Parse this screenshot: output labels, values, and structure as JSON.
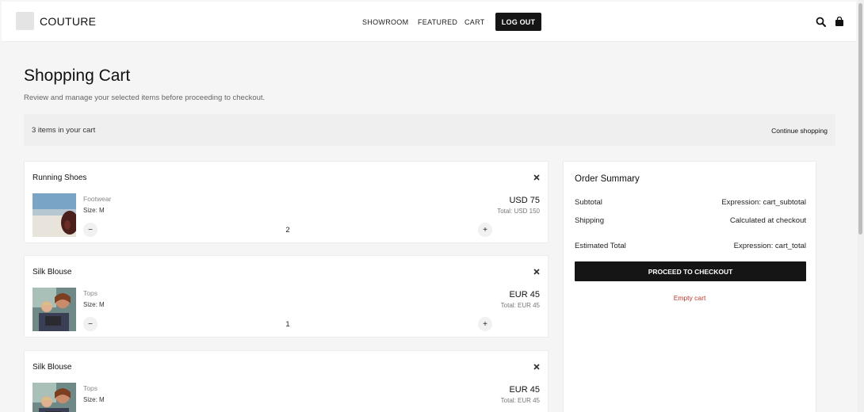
{
  "header": {
    "brand": "COUTURE",
    "nav": [
      "SHOWROOM",
      "FEATURED",
      "CART"
    ],
    "logout_label": "LOG OUT"
  },
  "page": {
    "title": "Shopping Cart",
    "subtitle": "Review and manage your selected items before proceeding to checkout.",
    "item_count": "3 items in your cart",
    "continue_shopping": "Continue shopping"
  },
  "items": [
    {
      "name": "Running Shoes",
      "category": "Footwear",
      "size": "Size: M",
      "price": "USD 75",
      "total": "Total: USD 150",
      "quantity": "2"
    },
    {
      "name": "Silk Blouse",
      "category": "Tops",
      "size": "Size: M",
      "price": "EUR 45",
      "total": "Total: EUR 45",
      "quantity": "1"
    },
    {
      "name": "Silk Blouse",
      "category": "Tops",
      "size": "Size: M",
      "price": "EUR 45",
      "total": "Total: EUR 45",
      "quantity": "1"
    }
  ],
  "summary": {
    "title": "Order Summary",
    "subtotal_label": "Subtotal",
    "subtotal_value": "Expression: cart_subtotal",
    "shipping_label": "Shipping",
    "shipping_value": "Calculated at checkout",
    "estimated_label": "Estimated Total",
    "estimated_value": "Expression: cart_total",
    "checkout_label": "PROCEED TO CHECKOUT",
    "empty_label": "Empty cart"
  },
  "icons": {
    "search": "search-icon",
    "bag": "shopping-bag-icon",
    "remove": "close-icon",
    "minus": "minus-icon",
    "plus": "plus-icon"
  },
  "colors": {
    "primary": "#151515",
    "danger": "#c0392b",
    "background": "#f5f5f5"
  }
}
